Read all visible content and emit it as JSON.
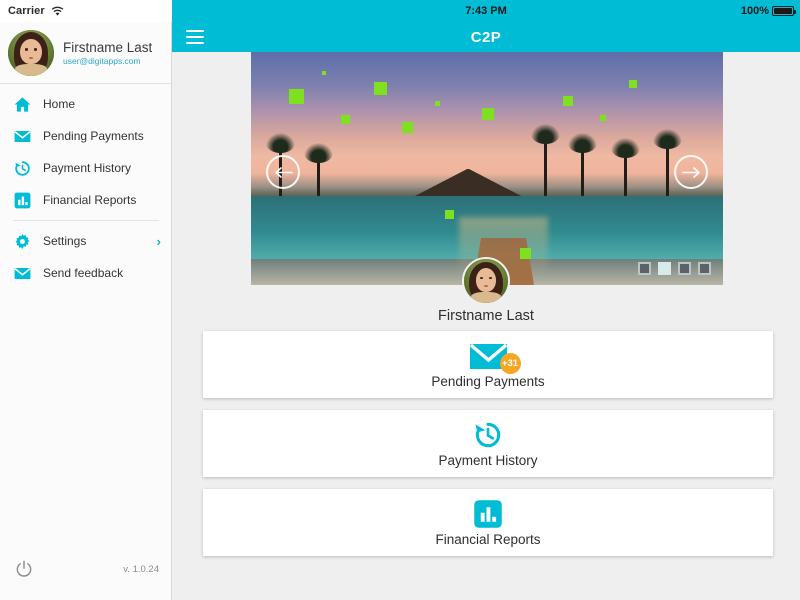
{
  "status_bar": {
    "carrier": "Carrier",
    "wifi_icon": "wifi-icon",
    "time": "7:43 PM",
    "battery_percent": "100%",
    "battery_icon": "battery-full-icon"
  },
  "app_bar": {
    "menu_icon": "hamburger-menu-icon",
    "title": "C2P",
    "background_color": "#00bcd4"
  },
  "sidebar": {
    "profile": {
      "name": "Firstname Last",
      "email": "user@digitapps.com",
      "avatar_icon": "avatar"
    },
    "items": [
      {
        "label": "Home",
        "icon": "home-icon"
      },
      {
        "label": "Pending Payments",
        "icon": "envelope-icon"
      },
      {
        "label": "Payment History",
        "icon": "history-clock-icon"
      },
      {
        "label": "Financial Reports",
        "icon": "bar-chart-icon"
      },
      {
        "label": "Settings",
        "icon": "gear-icon",
        "chevron": "›"
      },
      {
        "label": "Send feedback",
        "icon": "envelope-icon"
      }
    ],
    "footer": {
      "power_icon": "power-icon",
      "version": "v. 1.0.24"
    },
    "accent_color": "#00bcd4"
  },
  "main": {
    "carousel": {
      "prev_icon": "arrow-left-icon",
      "next_icon": "arrow-right-icon",
      "slide_count": 4,
      "active_slide": 2,
      "image_description": "tropical beach resort at sunset with pier and palm trees"
    },
    "hero": {
      "avatar_icon": "avatar",
      "name": "Firstname Last"
    },
    "cards": [
      {
        "label": "Pending Payments",
        "icon": "envelope-icon",
        "badge": "+31",
        "badge_color": "#f5a623",
        "icon_color": "#00bcd4"
      },
      {
        "label": "Payment History",
        "icon": "history-clock-icon",
        "badge": "",
        "icon_color": "#00bcd4"
      },
      {
        "label": "Financial Reports",
        "icon": "bar-chart-icon",
        "badge": "",
        "icon_color": "#00bcd4"
      }
    ]
  }
}
